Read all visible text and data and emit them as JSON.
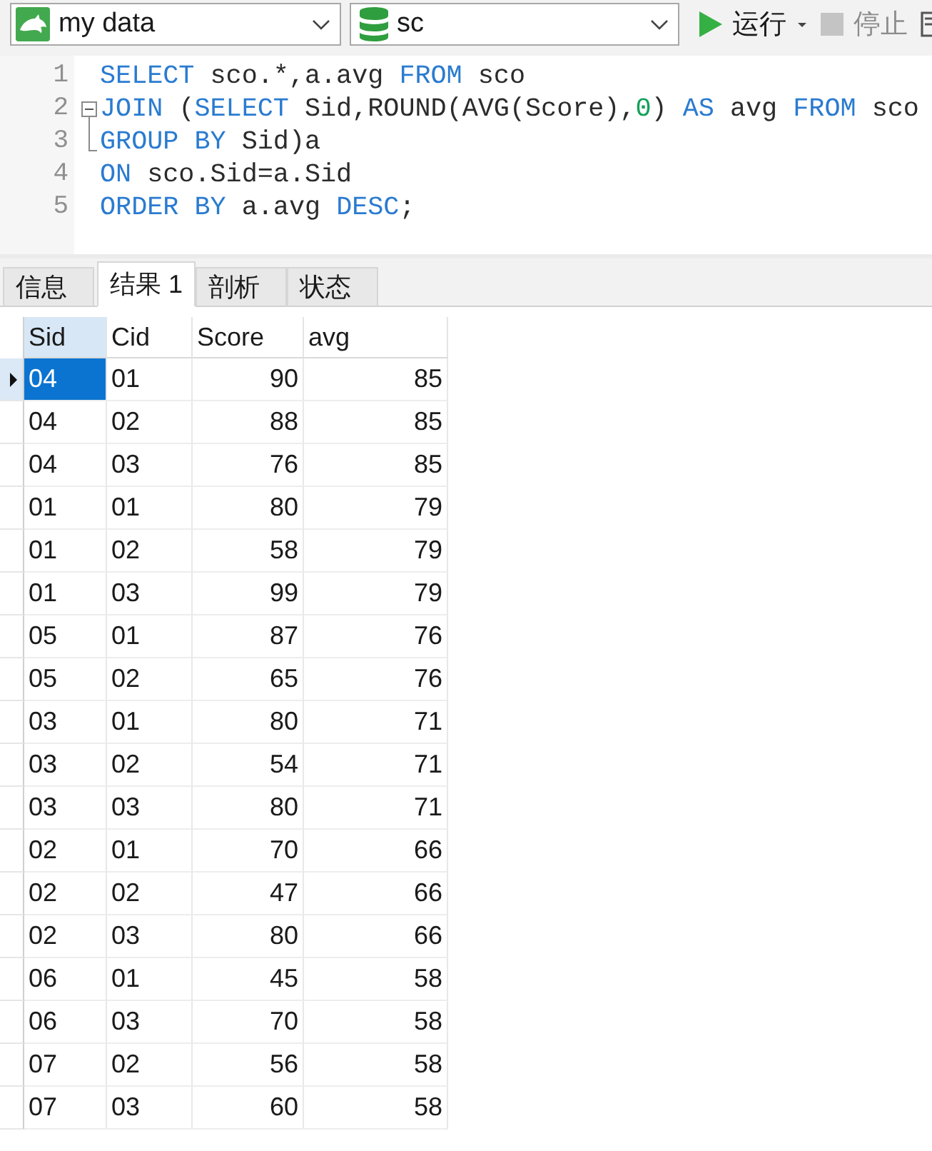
{
  "toolbar": {
    "connection": {
      "value": "my data"
    },
    "database": {
      "value": "sc"
    },
    "buttons": [
      {
        "kind": "run",
        "label": "运行",
        "disabled": false,
        "menu": true
      },
      {
        "kind": "stop",
        "label": "停止",
        "disabled": true,
        "menu": false
      }
    ]
  },
  "editor": {
    "lines": [
      {
        "number": "1",
        "kind": "plain",
        "tokens": [
          {
            "kind": "keyword",
            "text": "SELECT"
          },
          {
            "kind": "plain",
            "text": " sco.*,a.avg "
          },
          {
            "kind": "keyword",
            "text": "FROM"
          },
          {
            "kind": "plain",
            "text": " sco"
          }
        ]
      },
      {
        "number": "2",
        "kind": "fold_start",
        "tokens": [
          {
            "kind": "keyword",
            "text": "JOIN"
          },
          {
            "kind": "plain",
            "text": " ("
          },
          {
            "kind": "keyword",
            "text": "SELECT"
          },
          {
            "kind": "plain",
            "text": " Sid,ROUND(AVG(Score),"
          },
          {
            "kind": "number",
            "text": "0"
          },
          {
            "kind": "plain",
            "text": ") "
          },
          {
            "kind": "keyword",
            "text": "AS"
          },
          {
            "kind": "plain",
            "text": " avg "
          },
          {
            "kind": "keyword",
            "text": "FROM"
          },
          {
            "kind": "plain",
            "text": " sco"
          }
        ]
      },
      {
        "number": "3",
        "kind": "fold_end",
        "tokens": [
          {
            "kind": "keyword",
            "text": "GROUP BY"
          },
          {
            "kind": "plain",
            "text": " Sid)a"
          }
        ]
      },
      {
        "number": "4",
        "kind": "plain",
        "tokens": [
          {
            "kind": "keyword",
            "text": "ON"
          },
          {
            "kind": "plain",
            "text": " sco.Sid=a.Sid"
          }
        ]
      },
      {
        "number": "5",
        "kind": "plain",
        "tokens": [
          {
            "kind": "keyword",
            "text": "ORDER BY"
          },
          {
            "kind": "plain",
            "text": " a.avg "
          },
          {
            "kind": "keyword",
            "text": "DESC"
          },
          {
            "kind": "plain",
            "text": ";"
          }
        ]
      }
    ]
  },
  "result_tabs": [
    {
      "label": "信息",
      "selected": false
    },
    {
      "label": "结果 1",
      "selected": true
    },
    {
      "label": "剖析",
      "selected": false
    },
    {
      "label": "状态",
      "selected": false
    }
  ],
  "grid": {
    "columns": [
      {
        "label": "Sid",
        "kind": "text",
        "selected": true
      },
      {
        "label": "Cid",
        "kind": "text",
        "selected": false
      },
      {
        "label": "Score",
        "kind": "number",
        "selected": false
      },
      {
        "label": "avg",
        "kind": "number",
        "selected": false
      }
    ],
    "rows": [
      {
        "selected": true,
        "cells": [
          {
            "text": "04",
            "selected": true
          },
          {
            "text": "01",
            "selected": false
          },
          {
            "text": "90",
            "selected": false
          },
          {
            "text": "85",
            "selected": false
          }
        ]
      },
      {
        "selected": false,
        "cells": [
          {
            "text": "04",
            "selected": false
          },
          {
            "text": "02",
            "selected": false
          },
          {
            "text": "88",
            "selected": false
          },
          {
            "text": "85",
            "selected": false
          }
        ]
      },
      {
        "selected": false,
        "cells": [
          {
            "text": "04",
            "selected": false
          },
          {
            "text": "03",
            "selected": false
          },
          {
            "text": "76",
            "selected": false
          },
          {
            "text": "85",
            "selected": false
          }
        ]
      },
      {
        "selected": false,
        "cells": [
          {
            "text": "01",
            "selected": false
          },
          {
            "text": "01",
            "selected": false
          },
          {
            "text": "80",
            "selected": false
          },
          {
            "text": "79",
            "selected": false
          }
        ]
      },
      {
        "selected": false,
        "cells": [
          {
            "text": "01",
            "selected": false
          },
          {
            "text": "02",
            "selected": false
          },
          {
            "text": "58",
            "selected": false
          },
          {
            "text": "79",
            "selected": false
          }
        ]
      },
      {
        "selected": false,
        "cells": [
          {
            "text": "01",
            "selected": false
          },
          {
            "text": "03",
            "selected": false
          },
          {
            "text": "99",
            "selected": false
          },
          {
            "text": "79",
            "selected": false
          }
        ]
      },
      {
        "selected": false,
        "cells": [
          {
            "text": "05",
            "selected": false
          },
          {
            "text": "01",
            "selected": false
          },
          {
            "text": "87",
            "selected": false
          },
          {
            "text": "76",
            "selected": false
          }
        ]
      },
      {
        "selected": false,
        "cells": [
          {
            "text": "05",
            "selected": false
          },
          {
            "text": "02",
            "selected": false
          },
          {
            "text": "65",
            "selected": false
          },
          {
            "text": "76",
            "selected": false
          }
        ]
      },
      {
        "selected": false,
        "cells": [
          {
            "text": "03",
            "selected": false
          },
          {
            "text": "01",
            "selected": false
          },
          {
            "text": "80",
            "selected": false
          },
          {
            "text": "71",
            "selected": false
          }
        ]
      },
      {
        "selected": false,
        "cells": [
          {
            "text": "03",
            "selected": false
          },
          {
            "text": "02",
            "selected": false
          },
          {
            "text": "54",
            "selected": false
          },
          {
            "text": "71",
            "selected": false
          }
        ]
      },
      {
        "selected": false,
        "cells": [
          {
            "text": "03",
            "selected": false
          },
          {
            "text": "03",
            "selected": false
          },
          {
            "text": "80",
            "selected": false
          },
          {
            "text": "71",
            "selected": false
          }
        ]
      },
      {
        "selected": false,
        "cells": [
          {
            "text": "02",
            "selected": false
          },
          {
            "text": "01",
            "selected": false
          },
          {
            "text": "70",
            "selected": false
          },
          {
            "text": "66",
            "selected": false
          }
        ]
      },
      {
        "selected": false,
        "cells": [
          {
            "text": "02",
            "selected": false
          },
          {
            "text": "02",
            "selected": false
          },
          {
            "text": "47",
            "selected": false
          },
          {
            "text": "66",
            "selected": false
          }
        ]
      },
      {
        "selected": false,
        "cells": [
          {
            "text": "02",
            "selected": false
          },
          {
            "text": "03",
            "selected": false
          },
          {
            "text": "80",
            "selected": false
          },
          {
            "text": "66",
            "selected": false
          }
        ]
      },
      {
        "selected": false,
        "cells": [
          {
            "text": "06",
            "selected": false
          },
          {
            "text": "01",
            "selected": false
          },
          {
            "text": "45",
            "selected": false
          },
          {
            "text": "58",
            "selected": false
          }
        ]
      },
      {
        "selected": false,
        "cells": [
          {
            "text": "06",
            "selected": false
          },
          {
            "text": "03",
            "selected": false
          },
          {
            "text": "70",
            "selected": false
          },
          {
            "text": "58",
            "selected": false
          }
        ]
      },
      {
        "selected": false,
        "cells": [
          {
            "text": "07",
            "selected": false
          },
          {
            "text": "02",
            "selected": false
          },
          {
            "text": "56",
            "selected": false
          },
          {
            "text": "58",
            "selected": false
          }
        ]
      },
      {
        "selected": false,
        "cells": [
          {
            "text": "07",
            "selected": false
          },
          {
            "text": "03",
            "selected": false
          },
          {
            "text": "60",
            "selected": false
          },
          {
            "text": "58",
            "selected": false
          }
        ]
      }
    ]
  }
}
